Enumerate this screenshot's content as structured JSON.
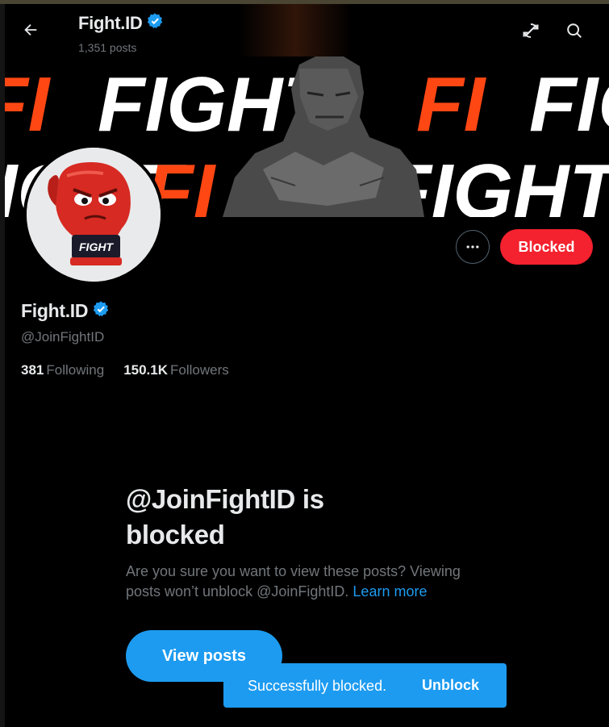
{
  "header": {
    "name": "Fight.ID",
    "posts_count": "1,351 posts"
  },
  "banner": {
    "text_main": "FIGHT",
    "text_accent": "FI",
    "accent_color": "#ff4713"
  },
  "avatar": {
    "glove_text": "FIGHT"
  },
  "profile": {
    "name": "Fight.ID",
    "handle": "@JoinFightID",
    "following_count": "381",
    "following_label": "Following",
    "followers_count": "150.1K",
    "followers_label": "Followers"
  },
  "actions": {
    "more_label": "···",
    "blocked_label": "Blocked"
  },
  "blocked_notice": {
    "title": "@JoinFightID is blocked",
    "description": "Are you sure you want to view these posts? Viewing posts won’t unblock @JoinFightID.",
    "learn_more": "Learn more",
    "view_posts_label": "View posts"
  },
  "toast": {
    "message": "Successfully blocked.",
    "action": "Unblock"
  },
  "colors": {
    "blue": "#1d9bf0",
    "red": "#f4212e",
    "muted": "#71767b",
    "text": "#e7e9ea"
  },
  "icons": {
    "back": "arrow-left-icon",
    "refresh": "refresh-icon",
    "search": "search-icon",
    "verified": "verified-badge-icon",
    "more": "more-horizontal-icon"
  }
}
